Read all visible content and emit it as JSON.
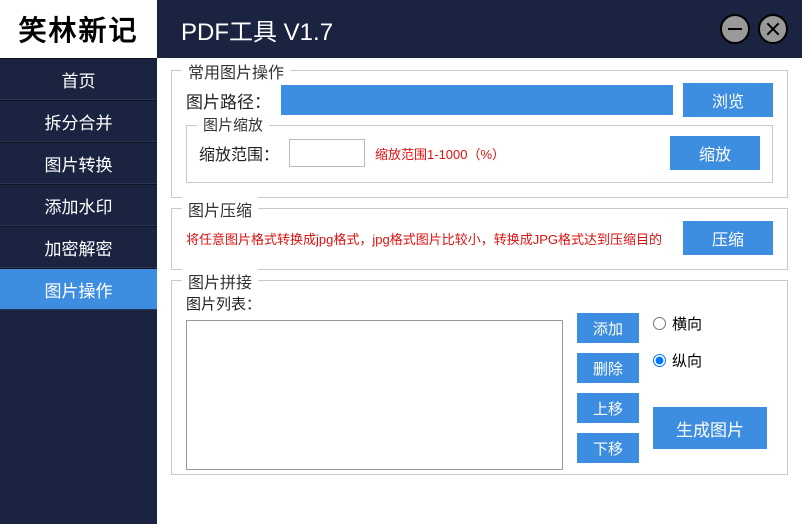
{
  "header": {
    "logo": "笑林新记",
    "title": "PDF工具 V1.7"
  },
  "sidebar": {
    "items": [
      {
        "label": "首页"
      },
      {
        "label": "拆分合并"
      },
      {
        "label": "图片转换"
      },
      {
        "label": "添加水印"
      },
      {
        "label": "加密解密"
      },
      {
        "label": "图片操作"
      }
    ]
  },
  "sections": {
    "common": {
      "title": "常用图片操作",
      "path_label": "图片路径：",
      "path_value": "",
      "browse": "浏览",
      "scale_group": "图片缩放",
      "scale_label": "缩放范围：",
      "scale_value": "",
      "scale_hint": "缩放范围1-1000（%）",
      "scale_btn": "缩放"
    },
    "compress": {
      "title": "图片压缩",
      "desc": "将任意图片格式转换成jpg格式，jpg格式图片比较小，转换成JPG格式达到压缩目的",
      "btn": "压缩"
    },
    "stitch": {
      "title": "图片拼接",
      "list_label": "图片列表：",
      "add": "添加",
      "del": "删除",
      "up": "上移",
      "down": "下移",
      "horiz": "横向",
      "vert": "纵向",
      "gen": "生成图片"
    }
  }
}
